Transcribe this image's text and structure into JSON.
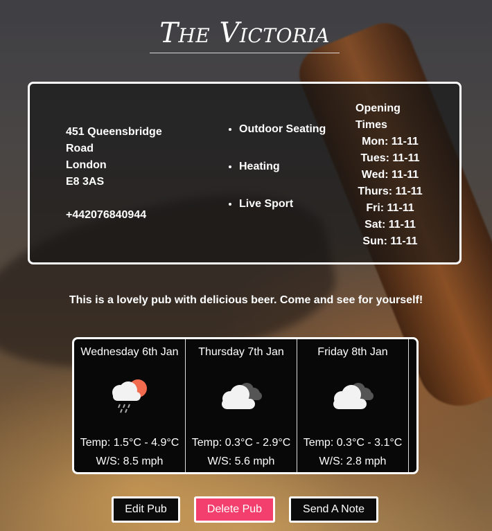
{
  "pub": {
    "name": "The Victoria",
    "address": [
      "451 Queensbridge",
      "Road",
      "London",
      "E8 3AS"
    ],
    "phone": "+442076840944",
    "facilities": [
      "Outdoor Seating",
      "Heating",
      "Live Sport"
    ],
    "hours_heading": [
      "Opening",
      "Times"
    ],
    "hours": [
      "Mon: 11-11",
      "Tues: 11-11",
      "Wed: 11-11",
      "Thurs: 11-11",
      "Fri: 11-11",
      "Sat: 11-11",
      "Sun: 11-11"
    ],
    "description": "This is a lovely pub with delicious beer. Come and see for yourself!"
  },
  "weather": [
    {
      "date": "Wednesday 6th Jan",
      "icon": "rain-sun-cloud-icon",
      "temp": "Temp: 1.5°C - 4.9°C",
      "wind": "W/S: 8.5 mph"
    },
    {
      "date": "Thursday 7th Jan",
      "icon": "cloudy-icon",
      "temp": "Temp: 0.3°C - 2.9°C",
      "wind": "W/S: 5.6 mph"
    },
    {
      "date": "Friday 8th Jan",
      "icon": "cloudy-icon",
      "temp": "Temp: 0.3°C - 3.1°C",
      "wind": "W/S: 2.8 mph"
    }
  ],
  "actions": {
    "edit": "Edit Pub",
    "delete": "Delete Pub",
    "note": "Send A Note"
  },
  "colors": {
    "delete_button": "#f23f6e",
    "sun": "#f26b4f"
  }
}
